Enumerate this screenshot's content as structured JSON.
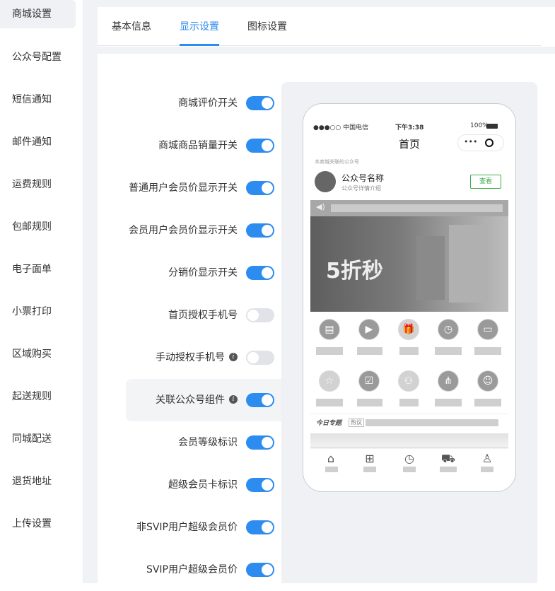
{
  "sidebar": {
    "items": [
      {
        "label": "商城设置",
        "active": true
      },
      {
        "label": "公众号配置"
      },
      {
        "label": "短信通知"
      },
      {
        "label": "邮件通知"
      },
      {
        "label": "运费规则"
      },
      {
        "label": "包邮规则"
      },
      {
        "label": "电子面单"
      },
      {
        "label": "小票打印"
      },
      {
        "label": "区域购买"
      },
      {
        "label": "起送规则"
      },
      {
        "label": "同城配送"
      },
      {
        "label": "退货地址"
      },
      {
        "label": "上传设置"
      }
    ]
  },
  "tabs": [
    {
      "label": "基本信息"
    },
    {
      "label": "显示设置",
      "active": true
    },
    {
      "label": "图标设置"
    }
  ],
  "settings": [
    {
      "label": "商城评价开关",
      "on": true
    },
    {
      "label": "商城商品销量开关",
      "on": true
    },
    {
      "label": "普通用户会员价显示开关",
      "on": true
    },
    {
      "label": "会员用户会员价显示开关",
      "on": true
    },
    {
      "label": "分销价显示开关",
      "on": true
    },
    {
      "label": "首页授权手机号",
      "on": false
    },
    {
      "label": "手动授权手机号",
      "on": false,
      "info": true
    },
    {
      "label": "关联公众号组件",
      "on": true,
      "info": true,
      "highlighted": true
    },
    {
      "label": "会员等级标识",
      "on": true
    },
    {
      "label": "超级会员卡标识",
      "on": true
    },
    {
      "label": "非SVIP用户超级会员价",
      "on": true
    },
    {
      "label": "SVIP用户超级会员价",
      "on": true
    }
  ],
  "preview": {
    "status_left": "●●●○○ 中国电信",
    "status_time": "下午3:38",
    "status_right": "100%",
    "title": "首页",
    "official_hint": "本商城关联的公众号",
    "official_name": "公众号名称",
    "official_desc": "公众号详情介绍",
    "view_button": "查看",
    "banner_text": "5折秒",
    "today_label": "今日专题",
    "hot_tag": "热议"
  },
  "colors": {
    "accent": "#2d8cf0",
    "switch_off": "#e1e3e8",
    "view_button": "#3cac4c"
  }
}
